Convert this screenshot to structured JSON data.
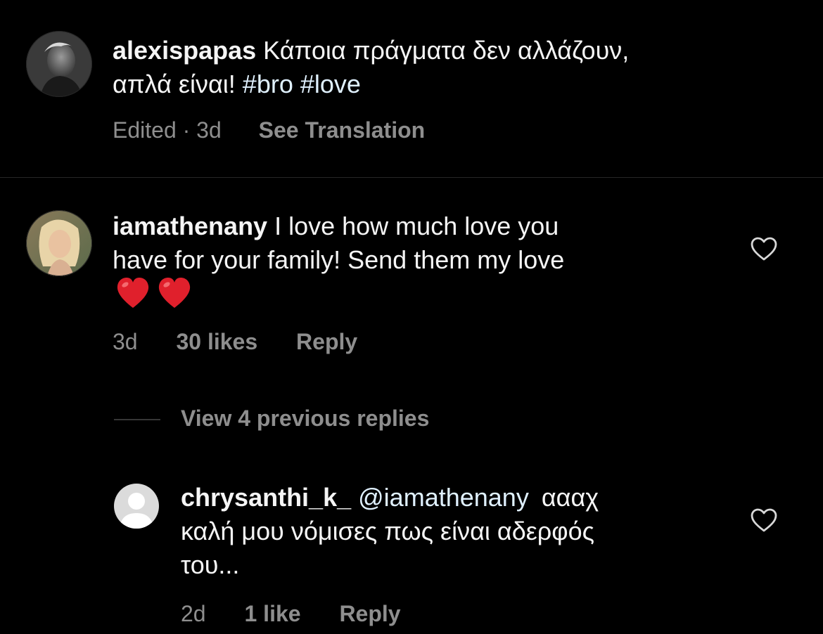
{
  "colors": {
    "background": "#000000",
    "text": "#f5f5f5",
    "secondary": "#8e8e8e",
    "link": "#e0f1ff",
    "divider": "#262626",
    "heart_emoji": "#e0202c"
  },
  "caption": {
    "username": "alexispapas",
    "text_line1": "Κάποια πράγματα δεν αλλάζουν,",
    "text_line2": "απλά είναι!",
    "hashtags": [
      "#bro",
      "#love"
    ],
    "edited_label": "Edited · 3d",
    "translation_label": "See Translation",
    "avatar_icon": "profile-photo"
  },
  "comment1": {
    "username": "iamathenany",
    "text_line1": "I love how much love you",
    "text_line2": "have for your family! Send them my love",
    "emojis": [
      "heart-emoji",
      "heart-emoji"
    ],
    "time": "3d",
    "likes": "30 likes",
    "reply_label": "Reply",
    "like_icon": "heart-outline-icon"
  },
  "replies_toggle": {
    "label": "View 4 previous replies"
  },
  "reply1": {
    "username": "chrysanthi_k_",
    "mention": "@iamathenany",
    "text_line1": "αααχ",
    "text_line2": "καλή μου νόμισες πως είναι αδερφός",
    "text_line3": "του...",
    "time": "2d",
    "likes": "1 like",
    "reply_label": "Reply",
    "avatar_icon": "default-avatar-icon",
    "like_icon": "heart-outline-icon"
  }
}
